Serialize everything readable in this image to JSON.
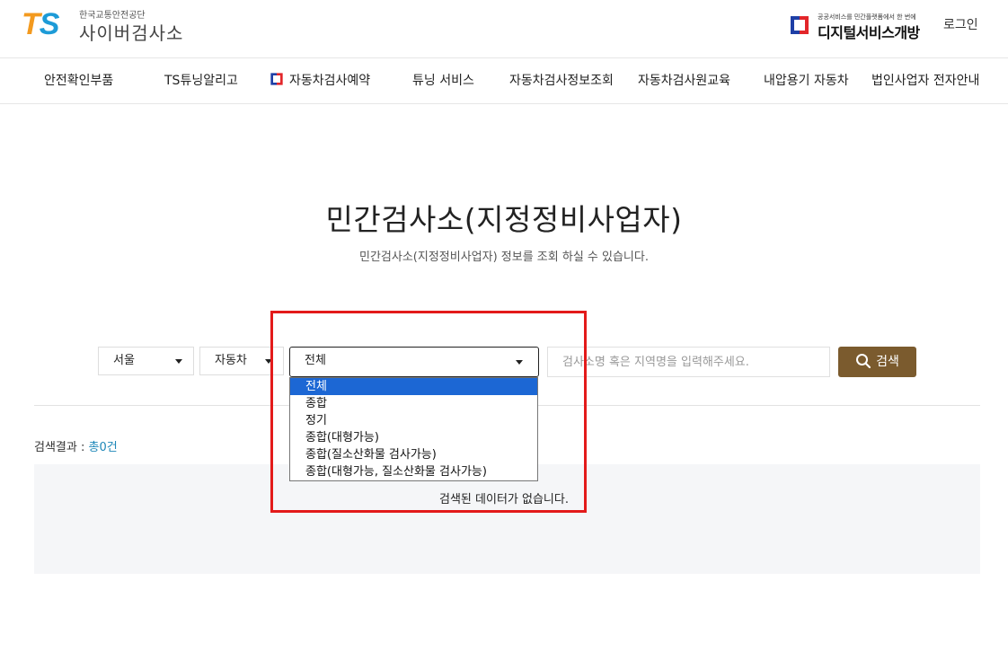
{
  "header": {
    "org_name": "한국교통안전공단",
    "site_name": "사이버검사소",
    "digital_tagline": "공공서비스를 민간플랫폼에서 한 번에",
    "digital_title": "디지털서비스개방",
    "login_label": "로그인"
  },
  "nav": [
    {
      "label": "안전확인부품"
    },
    {
      "label": "TS튜닝알리고"
    },
    {
      "label": "자동차검사예약"
    },
    {
      "label": "튜닝 서비스"
    },
    {
      "label": "자동차검사정보조회"
    },
    {
      "label": "자동차검사원교육"
    },
    {
      "label": "내압용기 자동차"
    },
    {
      "label": "법인사업자 전자안내"
    }
  ],
  "page": {
    "title": "민간검사소(지정정비사업자)",
    "subtitle": "민간검사소(지정정비사업자) 정보를 조회 하실 수 있습니다."
  },
  "search": {
    "region_value": "서울",
    "vehicle_value": "자동차",
    "type_value": "전체",
    "keyword_placeholder": "검사소명 혹은 지역명을 입력해주세요.",
    "button_label": "검색"
  },
  "dropdown": {
    "options": [
      "전체",
      "종합",
      "정기",
      "종합(대형가능)",
      "종합(질소산화물 검사가능)",
      "종합(대형가능, 질소산화물 검사가능)"
    ],
    "selected": "전체"
  },
  "results": {
    "label": "검색결과 : ",
    "count": "총0건",
    "empty_message": "검색된 데이터가 없습니다."
  },
  "colors": {
    "brand_brown": "#7b5b2e",
    "logo_orange": "#f39a1f",
    "logo_blue": "#1d9bd7",
    "selection_blue": "#1c67d4",
    "highlight_red": "#e31a1a"
  }
}
